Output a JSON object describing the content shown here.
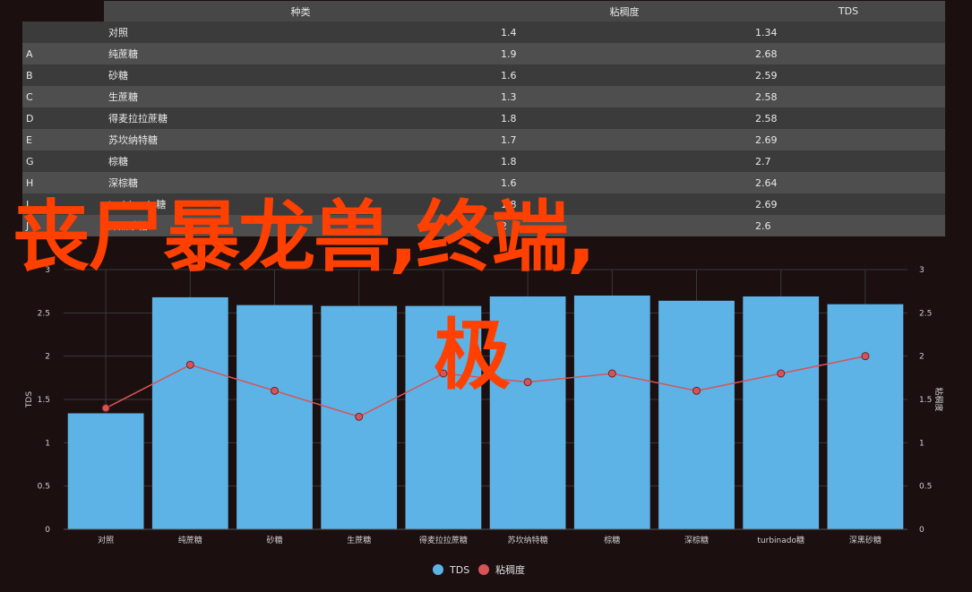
{
  "table": {
    "headers": [
      "",
      "种类",
      "粘稠度",
      "TDS"
    ],
    "rows": [
      [
        "",
        "对照",
        "1.4",
        "1.34"
      ],
      [
        "A",
        "纯蔗糖",
        "1.9",
        "2.68"
      ],
      [
        "B",
        "砂糖",
        "1.6",
        "2.59"
      ],
      [
        "C",
        "生蔗糖",
        "1.3",
        "2.58"
      ],
      [
        "D",
        "得麦拉拉蔗糖",
        "1.8",
        "2.58"
      ],
      [
        "E",
        "苏坎纳特糖",
        "1.7",
        "2.69"
      ],
      [
        "G",
        "棕糖",
        "1.8",
        "2.7"
      ],
      [
        "H",
        "深棕糖",
        "1.6",
        "2.64"
      ],
      [
        "I",
        "turbinado糖",
        "1.8",
        "2.69"
      ],
      [
        "J",
        "深黑砂糖",
        "2",
        "2.6"
      ]
    ]
  },
  "chart_data": {
    "type": "bar",
    "categories": [
      "对照",
      "纯蔗糖",
      "砂糖",
      "生蔗糖",
      "得麦拉拉蔗糖",
      "苏坎纳特糖",
      "棕糖",
      "深棕糖",
      "turbinado糖",
      "深黑砂糖"
    ],
    "series": [
      {
        "name": "TDS",
        "type": "bar",
        "axis": "left",
        "color": "#5db3e6",
        "values": [
          1.34,
          2.68,
          2.59,
          2.58,
          2.58,
          2.69,
          2.7,
          2.64,
          2.69,
          2.6
        ]
      },
      {
        "name": "粘稠度",
        "type": "line",
        "axis": "right",
        "color": "#d65458",
        "values": [
          1.4,
          1.9,
          1.6,
          1.3,
          1.8,
          1.7,
          1.8,
          1.6,
          1.8,
          2
        ]
      }
    ],
    "ylabel": "TDS",
    "y2label": "粘稠度",
    "ylim": [
      0,
      3
    ],
    "y2lim": [
      0,
      3
    ],
    "yticks": [
      "0",
      "0.5",
      "1",
      "1.5",
      "2",
      "2.5",
      "3"
    ],
    "grid": true,
    "legend": "bottom"
  },
  "overlay": {
    "line1": "丧尸暴龙兽,终端,",
    "line2": "极"
  }
}
